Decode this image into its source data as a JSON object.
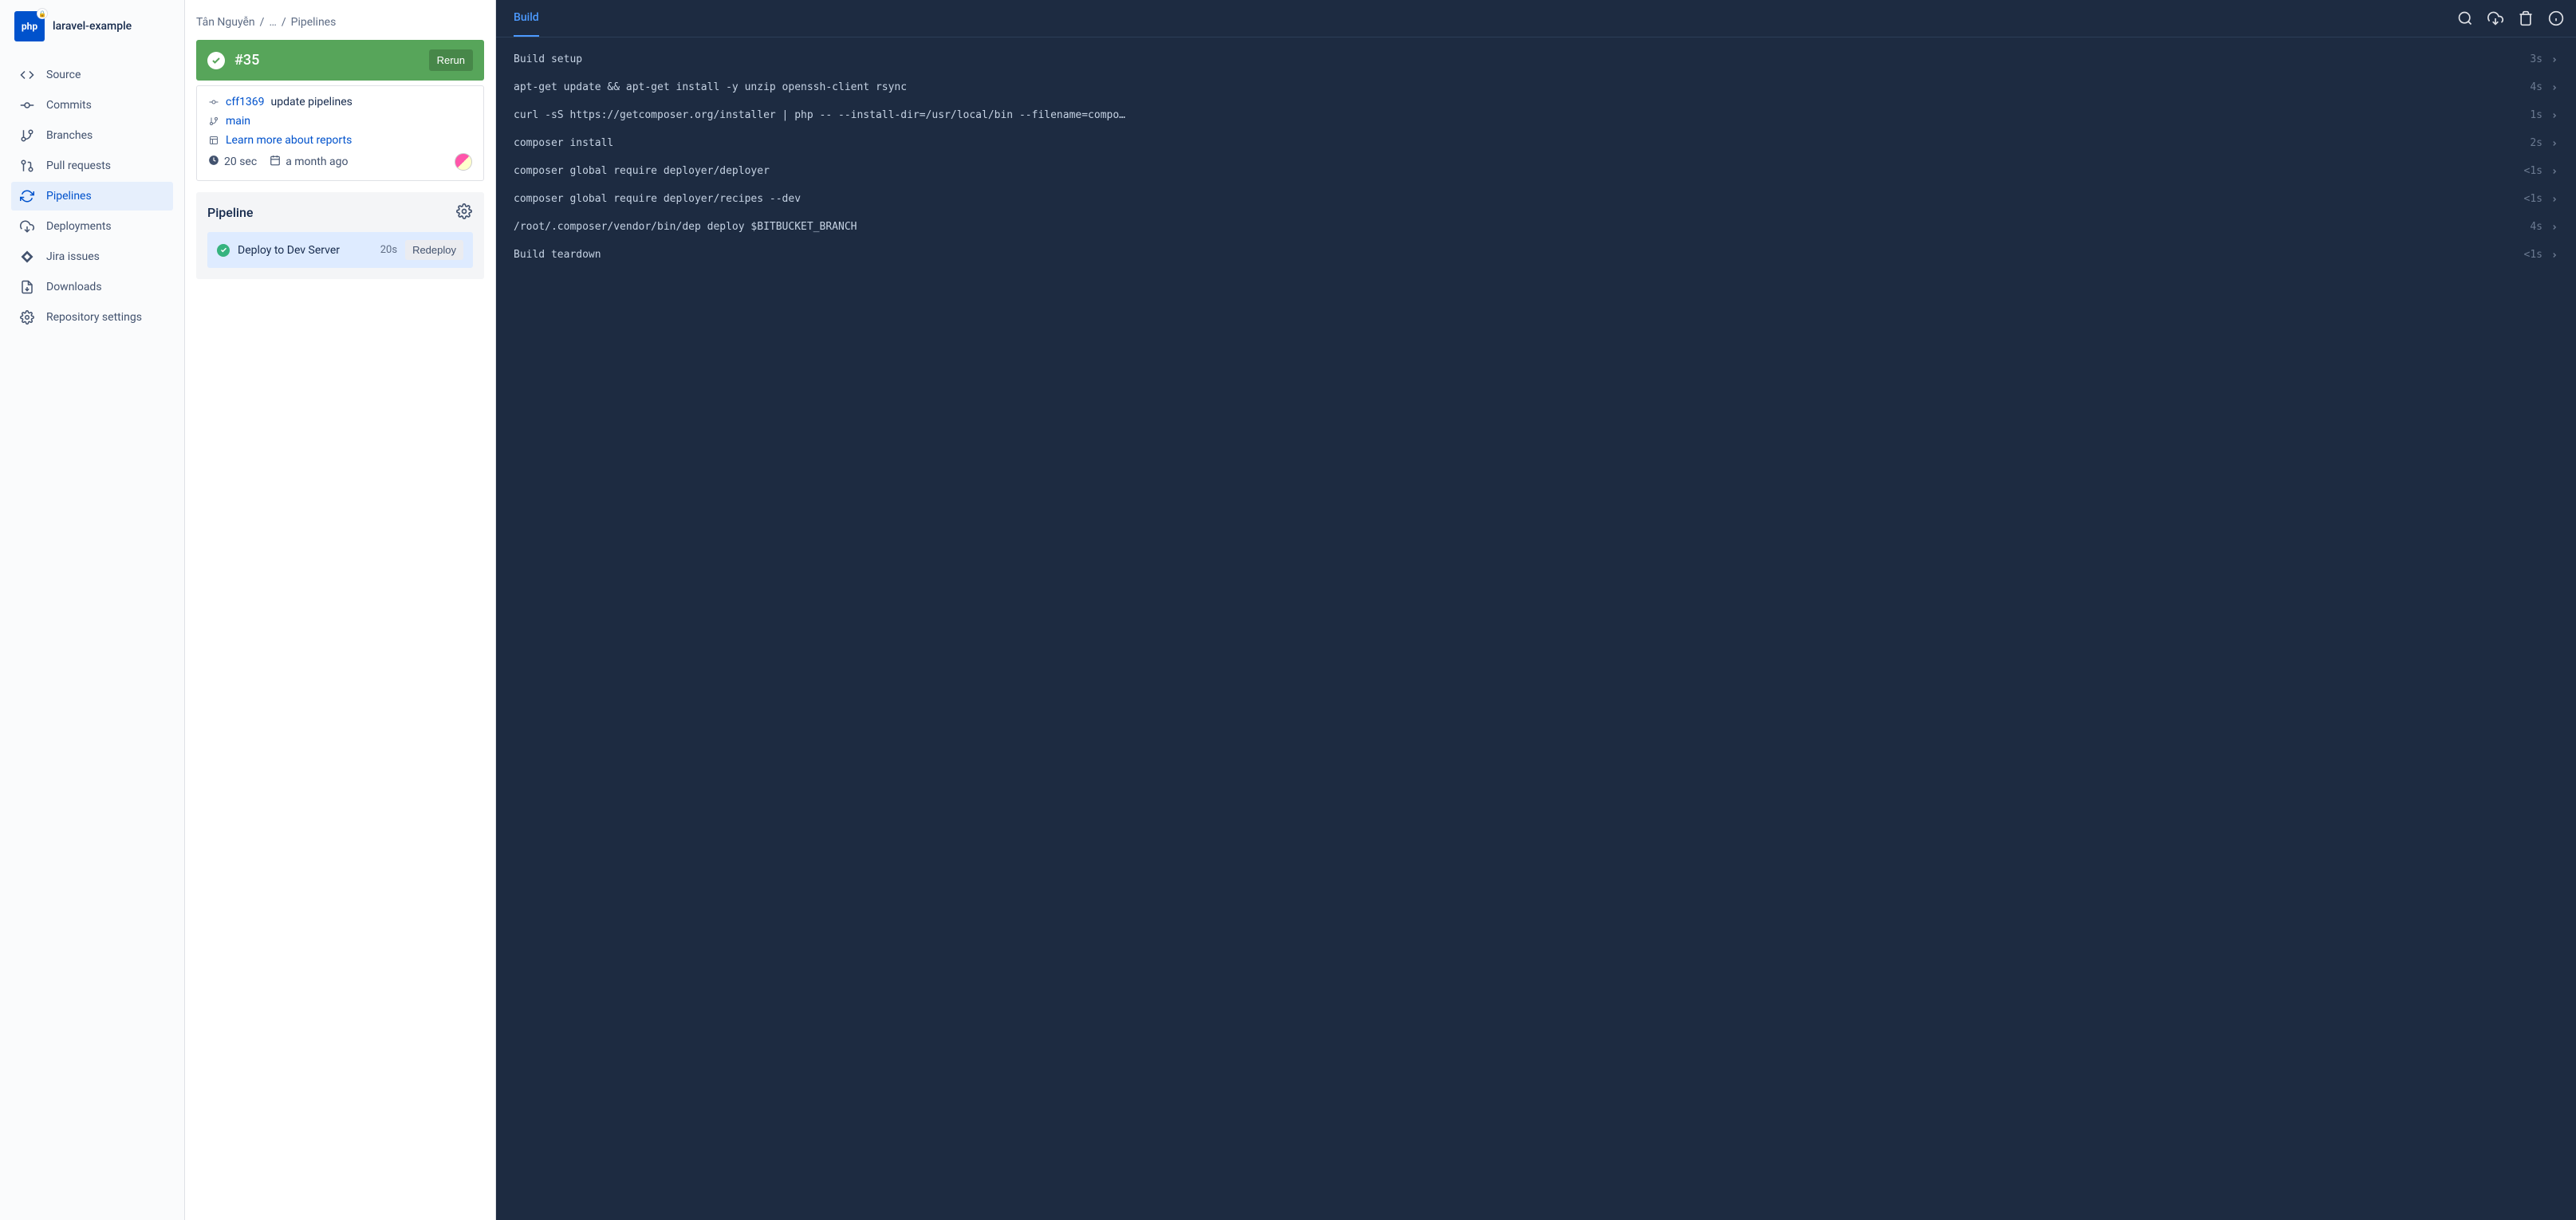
{
  "repo": {
    "name": "laravel-example",
    "icon_text": "php"
  },
  "sidebar": {
    "items": [
      {
        "label": "Source"
      },
      {
        "label": "Commits"
      },
      {
        "label": "Branches"
      },
      {
        "label": "Pull requests"
      },
      {
        "label": "Pipelines"
      },
      {
        "label": "Deployments"
      },
      {
        "label": "Jira issues"
      },
      {
        "label": "Downloads"
      },
      {
        "label": "Repository settings"
      }
    ],
    "active_index": 4
  },
  "breadcrumb": {
    "owner": "Tân Nguyễn",
    "ellipsis": "…",
    "current": "Pipelines"
  },
  "run": {
    "number": "#35",
    "rerun_label": "Rerun",
    "commit_hash": "cff1369",
    "commit_msg": "update pipelines",
    "branch": "main",
    "report_link": "Learn more about reports",
    "duration": "20 sec",
    "when": "a month ago"
  },
  "pipeline": {
    "title": "Pipeline",
    "step_name": "Deploy to Dev Server",
    "step_duration": "20s",
    "redeploy_label": "Redeploy"
  },
  "log": {
    "tab": "Build",
    "rows": [
      {
        "cmd": "Build setup",
        "dur": "3s"
      },
      {
        "cmd": "apt-get update && apt-get install -y unzip openssh-client rsync",
        "dur": "4s"
      },
      {
        "cmd": "curl -sS https://getcomposer.org/installer | php -- --install-dir=/usr/local/bin --filename=compo…",
        "dur": "1s"
      },
      {
        "cmd": "composer install",
        "dur": "2s"
      },
      {
        "cmd": "composer global require deployer/deployer",
        "dur": "<1s"
      },
      {
        "cmd": "composer global require deployer/recipes --dev",
        "dur": "<1s"
      },
      {
        "cmd": "/root/.composer/vendor/bin/dep deploy $BITBUCKET_BRANCH",
        "dur": "4s"
      },
      {
        "cmd": "Build teardown",
        "dur": "<1s"
      }
    ]
  }
}
